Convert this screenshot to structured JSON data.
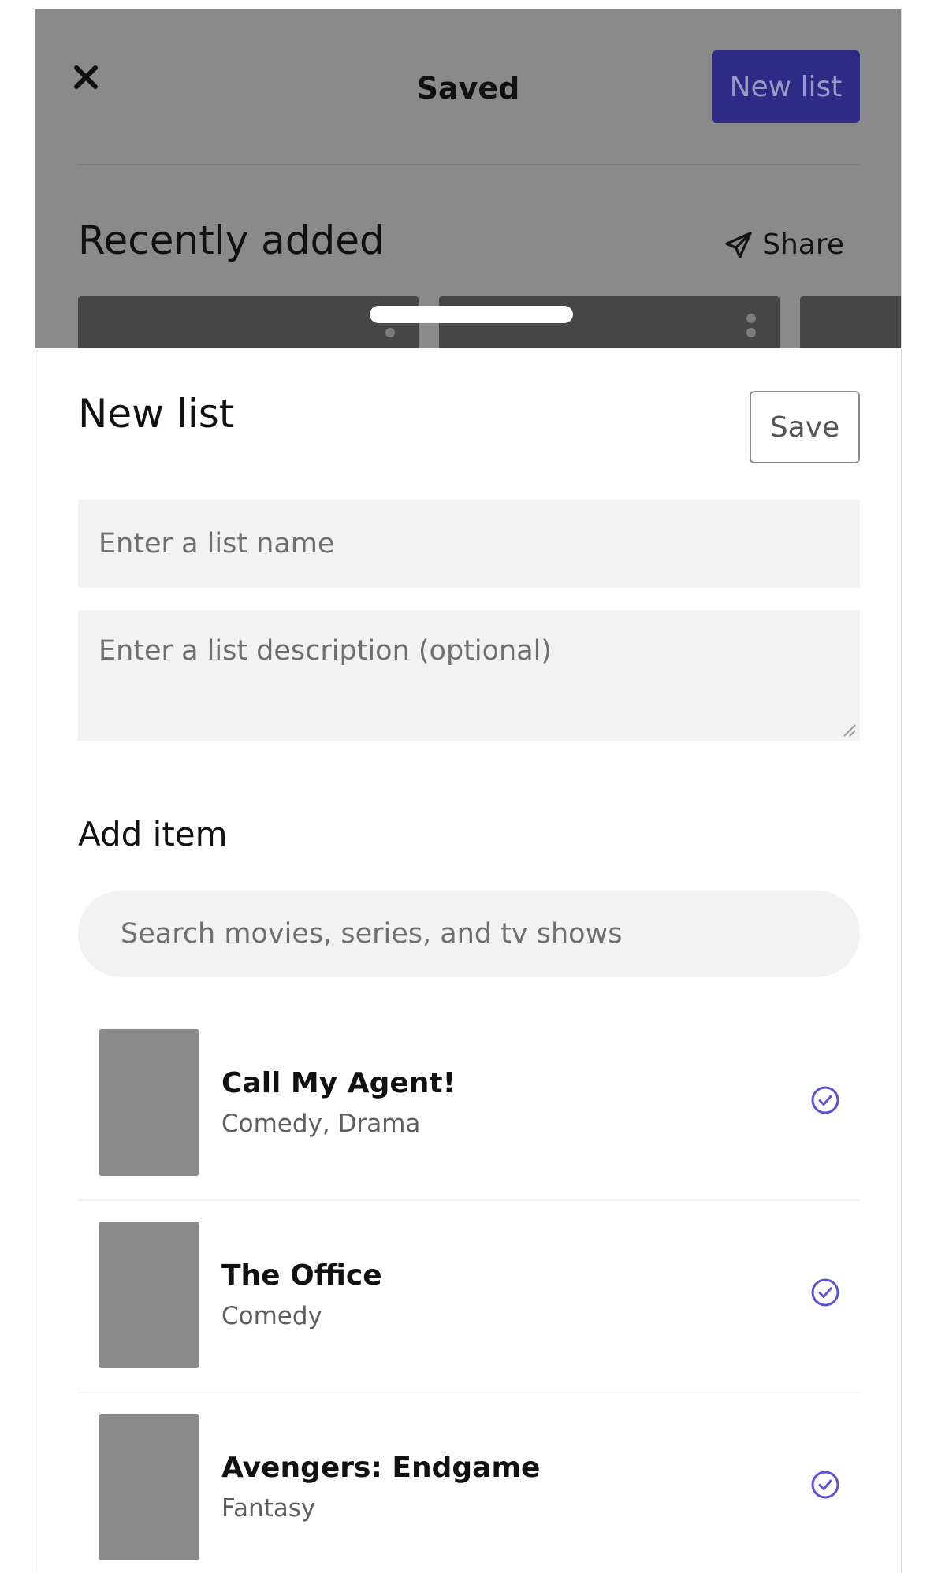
{
  "header": {
    "title": "Saved",
    "new_list_button": "New list",
    "close_icon": "close-icon"
  },
  "recent": {
    "title": "Recently added",
    "share_label": "Share",
    "share_icon": "send-icon"
  },
  "sheet": {
    "title": "New list",
    "save_label": "Save",
    "name_placeholder": "Enter a list name",
    "description_placeholder": "Enter a list description (optional)",
    "add_item_label": "Add item",
    "search_placeholder": "Search movies, series, and tv shows"
  },
  "results": [
    {
      "title": "Call My Agent!",
      "genre": "Comedy, Drama",
      "selected_icon": "check-circle-icon"
    },
    {
      "title": "The Office",
      "genre": "Comedy",
      "selected_icon": "check-circle-icon"
    },
    {
      "title": "Avengers: Endgame",
      "genre": "Fantasy",
      "selected_icon": "check-circle-icon"
    }
  ],
  "colors": {
    "accent": "#5b52d6",
    "primary_button": "#2e2a86",
    "overlay": "#8a8a8a"
  }
}
